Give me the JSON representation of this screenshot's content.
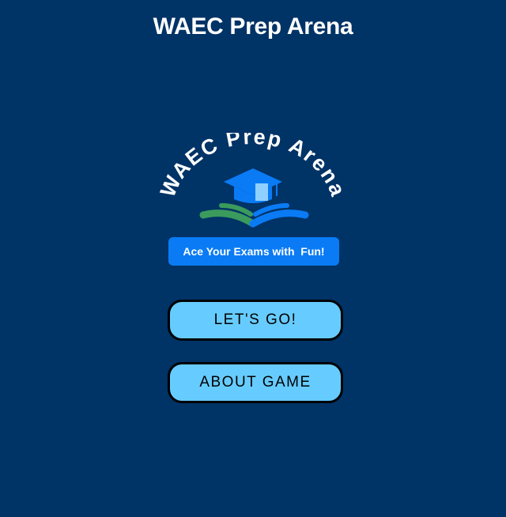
{
  "app": {
    "title": "WAEC Prep Arena"
  },
  "logo": {
    "arc_text": "WAEC Prep Arena",
    "tagline": "Ace Your Exams with  Fun!",
    "icon": "graduation-cap-book-icon"
  },
  "menu": {
    "start_label": "LET'S GO!",
    "about_label": "ABOUT GAME"
  },
  "colors": {
    "background": "#003366",
    "button_fill": "#66ccff",
    "button_border": "#000000",
    "tagline_fill": "#0a7bf5",
    "cap_blue": "#0a7bf5",
    "cap_light": "#8fd0ff",
    "book_green": "#3a9b5c",
    "book_blue": "#0a7bf5"
  }
}
